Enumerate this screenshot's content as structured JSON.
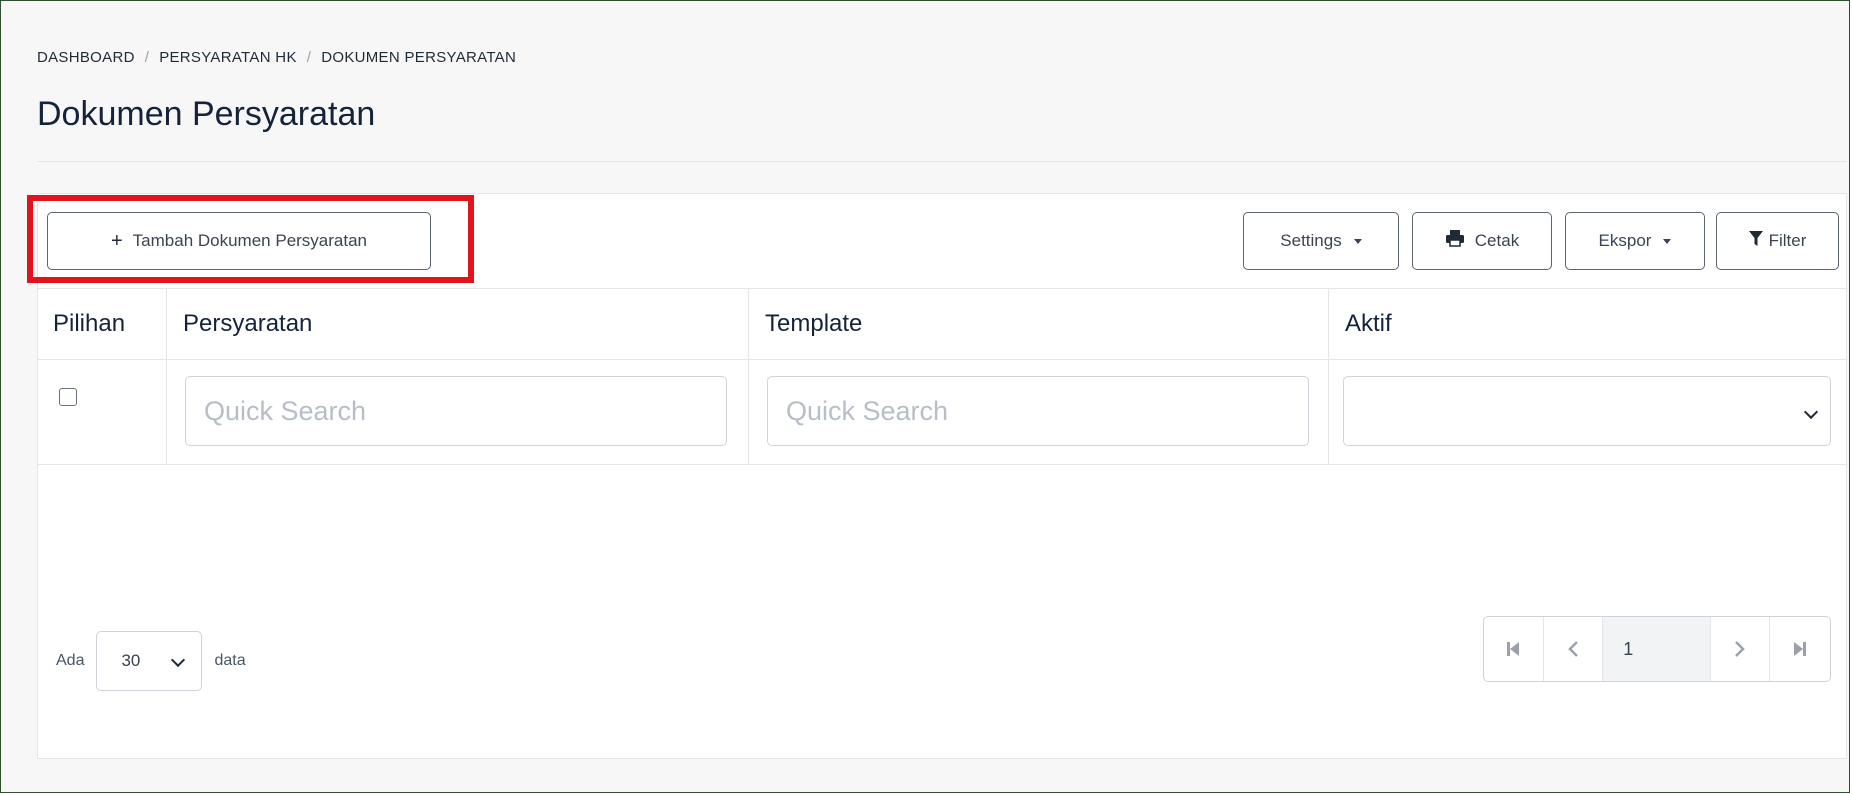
{
  "breadcrumb": {
    "items": [
      "DASHBOARD",
      "PERSYARATAN HK",
      "DOKUMEN PERSYARATAN"
    ],
    "separator": "/"
  },
  "page": {
    "title": "Dokumen Persyaratan"
  },
  "toolbar": {
    "add_label": "Tambah Dokumen Persyaratan",
    "settings_label": "Settings",
    "print_label": "Cetak",
    "export_label": "Ekspor",
    "filter_label": "Filter"
  },
  "table": {
    "columns": [
      "Pilihan",
      "Persyaratan",
      "Template",
      "Aktif"
    ],
    "search_placeholder": "Quick Search",
    "aktif_selected": ""
  },
  "pagination": {
    "prefix": "Ada",
    "per_page": "30",
    "suffix": "data",
    "current_page": "1"
  },
  "colors": {
    "highlight": "#e0141c",
    "border": "#e3e5e8",
    "text": "#15233a"
  }
}
